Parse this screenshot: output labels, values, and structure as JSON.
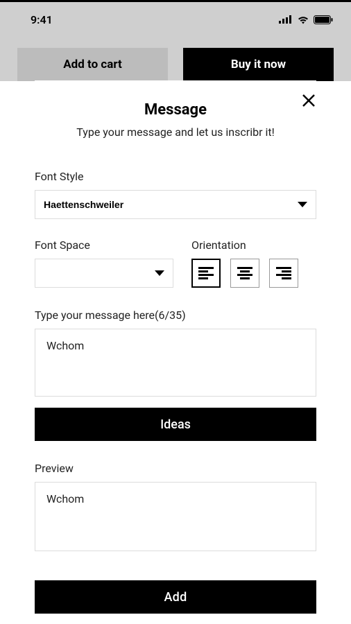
{
  "status": {
    "time": "9:41"
  },
  "topButtons": {
    "addToCart": "Add to cart",
    "buyNow": "Buy it now"
  },
  "modal": {
    "title": "Message",
    "subtitle": "Type your message and let us inscribr it!"
  },
  "form": {
    "fontStyleLabel": "Font Style",
    "fontStyleValue": "Haettenschweiler",
    "fontSpaceLabel": "Font Space",
    "fontSpaceValue": "",
    "orientationLabel": "Orientation",
    "messageLabel": "Type your message here(6/35)",
    "messageValue": "Wchom",
    "ideasButton": "Ideas",
    "previewLabel": "Preview",
    "previewValue": "Wchom",
    "addButton": "Add"
  }
}
